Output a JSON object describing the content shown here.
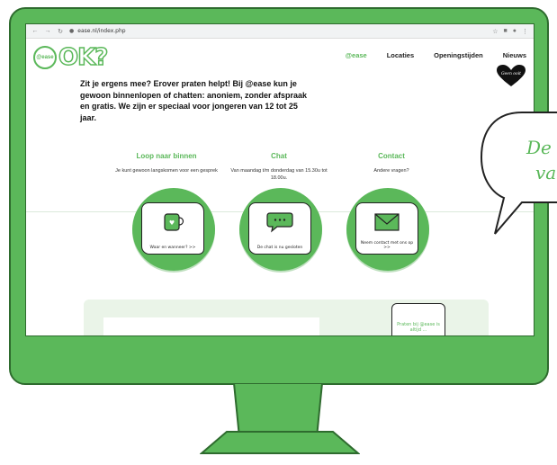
{
  "browser": {
    "url": "ease.nl/index.php"
  },
  "site": {
    "logo_small": "@ease",
    "logo_text": "OK?",
    "nav": [
      "@ease",
      "Locaties",
      "Openingstijden",
      "Nieuws"
    ],
    "badge": "Geen ooit",
    "intro": "Zit je ergens mee? Erover praten helpt! Bij @ease kun je gewoon binnenlopen of chatten: anoniem, zonder afspraak en gratis. We zijn er speciaal voor jongeren van 12 tot 25 jaar.",
    "columns": [
      {
        "title": "Loop naar binnen",
        "text": "Je kunt gewoon langskomen voor een gesprek",
        "card_caption": "Waar en wanneer? >>"
      },
      {
        "title": "Chat",
        "text": "Van maandag t/m donderdag van 15.30u tot 18.00u.",
        "card_caption": "De chat is nu gesloten"
      },
      {
        "title": "Contact",
        "text": "Andere vragen?",
        "card_caption": "Neem contact met ons op >>"
      }
    ],
    "lower_card": "Praten bij @ease is altijd ..."
  },
  "speech_bubble": {
    "line1": "De",
    "line2": "va"
  },
  "colors": {
    "accent": "#5bb85a",
    "dark": "#2e6b2e"
  }
}
